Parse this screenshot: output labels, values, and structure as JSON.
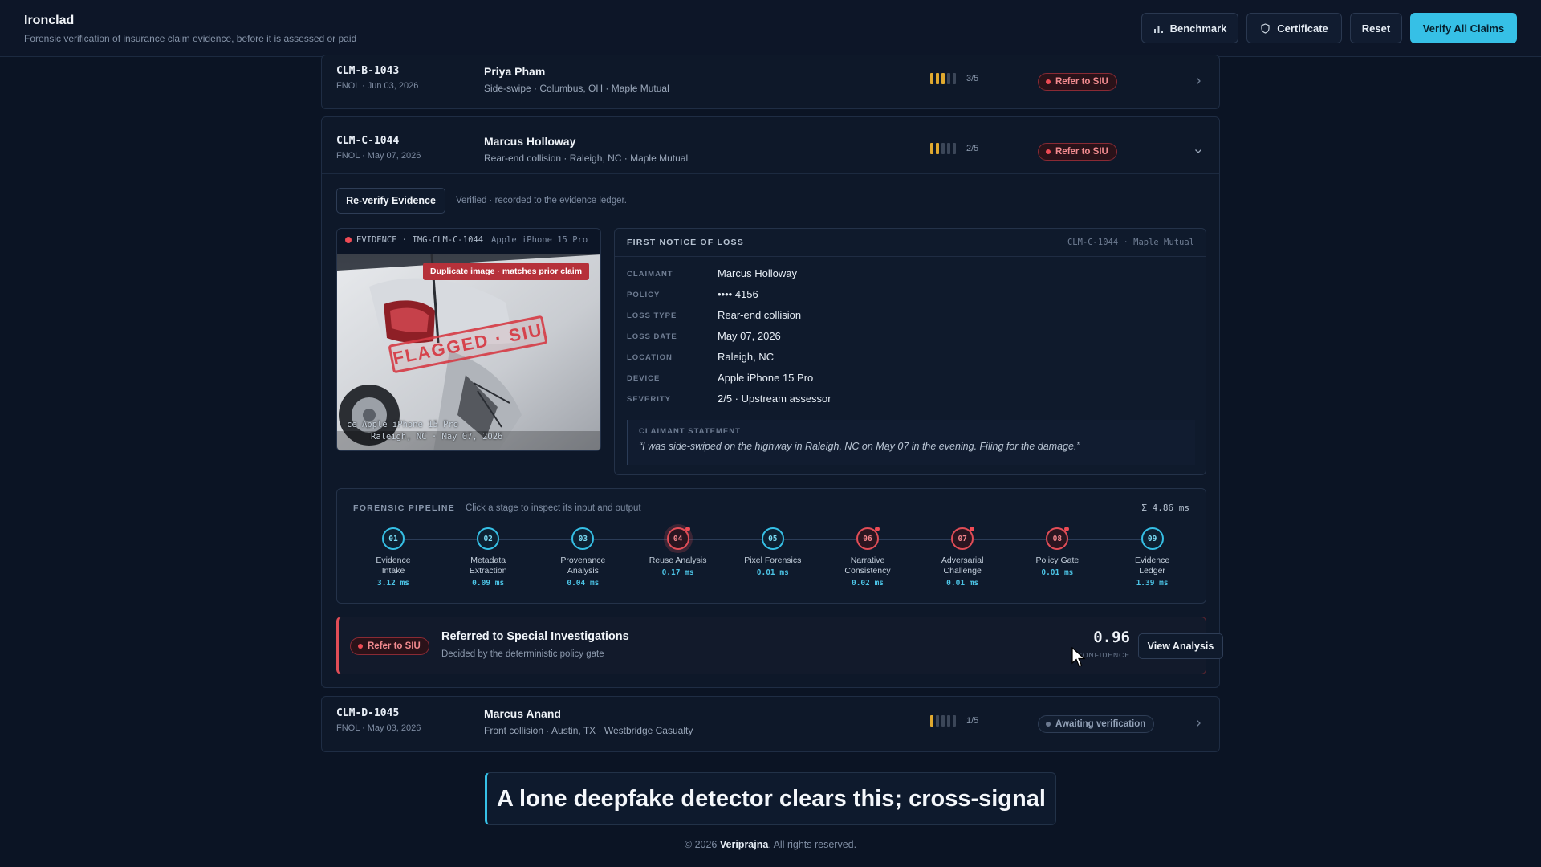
{
  "header": {
    "title": "Ironclad",
    "tagline": "Forensic verification of insurance claim evidence, before it is assessed or paid",
    "benchmark_label": "Benchmark",
    "certificate_label": "Certificate",
    "reset_label": "Reset",
    "verify_all_label": "Verify All Claims"
  },
  "claims": [
    {
      "id": "CLM-B-1043",
      "fnol": "FNOL · Jun 03, 2026",
      "name": "Priya Pham",
      "desc": "Side-swipe · Columbus, OH · Maple Mutual",
      "severity_text": "3/5",
      "severity": 3,
      "status": "Refer to SIU"
    },
    {
      "id": "CLM-C-1044",
      "fnol": "FNOL · May 07, 2026",
      "name": "Marcus Holloway",
      "desc": "Rear-end collision · Raleigh, NC · Maple Mutual",
      "severity_text": "2/5",
      "severity": 2,
      "status": "Refer to SIU"
    },
    {
      "id": "CLM-D-1045",
      "fnol": "FNOL · May 03, 2026",
      "name": "Marcus Anand",
      "desc": "Front collision · Austin, TX · Westbridge Casualty",
      "severity_text": "1/5",
      "severity": 1,
      "status": "Awaiting verification"
    }
  ],
  "expanded": {
    "reverify_label": "Re-verify Evidence",
    "reverify_note": "Verified · recorded to the evidence ledger.",
    "evidence": {
      "label": "EVIDENCE · IMG-CLM-C-1044",
      "device": "Apple iPhone 15 Pro",
      "dup_tag": "Duplicate image · matches prior claim",
      "stamp": "FLAGGED · SIU",
      "overlay_line1": "ce Apple iPhone 15 Pro",
      "overlay_line2": "Raleigh, NC · May 07, 2026"
    },
    "fnol": {
      "title": "FIRST NOTICE OF LOSS",
      "ref": "CLM-C-1044 · Maple Mutual",
      "fields": [
        {
          "k": "CLAIMANT",
          "v": "Marcus Holloway"
        },
        {
          "k": "POLICY",
          "v": "•••• 4156"
        },
        {
          "k": "LOSS TYPE",
          "v": "Rear-end collision"
        },
        {
          "k": "LOSS DATE",
          "v": "May 07, 2026"
        },
        {
          "k": "LOCATION",
          "v": "Raleigh, NC"
        },
        {
          "k": "DEVICE",
          "v": "Apple iPhone 15 Pro"
        },
        {
          "k": "SEVERITY",
          "v": "2/5 · Upstream assessor"
        }
      ],
      "statement_label": "CLAIMANT STATEMENT",
      "statement": "“I was side-swiped on the highway in Raleigh, NC on May 07 in the evening. Filing for the damage.”"
    },
    "pipeline": {
      "title": "FORENSIC PIPELINE",
      "hint": "Click a stage to inspect its input and output",
      "total": "Σ 4.86 ms",
      "stages": [
        {
          "n": "01",
          "l1": "Evidence",
          "l2": "Intake",
          "ms": "3.12 ms",
          "flag": false
        },
        {
          "n": "02",
          "l1": "Metadata",
          "l2": "Extraction",
          "ms": "0.09 ms",
          "flag": false
        },
        {
          "n": "03",
          "l1": "Provenance",
          "l2": "Analysis",
          "ms": "0.04 ms",
          "flag": false
        },
        {
          "n": "04",
          "l1": "Reuse Analysis",
          "l2": "",
          "ms": "0.17 ms",
          "flag": true
        },
        {
          "n": "05",
          "l1": "Pixel Forensics",
          "l2": "",
          "ms": "0.01 ms",
          "flag": false
        },
        {
          "n": "06",
          "l1": "Narrative",
          "l2": "Consistency",
          "ms": "0.02 ms",
          "flag": true
        },
        {
          "n": "07",
          "l1": "Adversarial",
          "l2": "Challenge",
          "ms": "0.01 ms",
          "flag": true
        },
        {
          "n": "08",
          "l1": "Policy Gate",
          "l2": "",
          "ms": "0.01 ms",
          "flag": true
        },
        {
          "n": "09",
          "l1": "Evidence",
          "l2": "Ledger",
          "ms": "1.39 ms",
          "flag": false
        }
      ]
    },
    "decision": {
      "badge": "Refer to SIU",
      "title": "Referred to Special Investigations",
      "sub": "Decided by the deterministic policy gate",
      "confidence": "0.96",
      "confidence_label": "CONFIDENCE",
      "view_label": "View Analysis"
    }
  },
  "caption": "A lone deepfake detector clears this; cross-signal",
  "footer": {
    "prefix": "© 2026",
    "brand": "Veriprajna",
    "suffix": ". All rights reserved."
  },
  "colors": {
    "accent": "#36c0e6",
    "danger": "#ef4b55",
    "severity": "#e0a92f",
    "background": "#0b1424"
  }
}
